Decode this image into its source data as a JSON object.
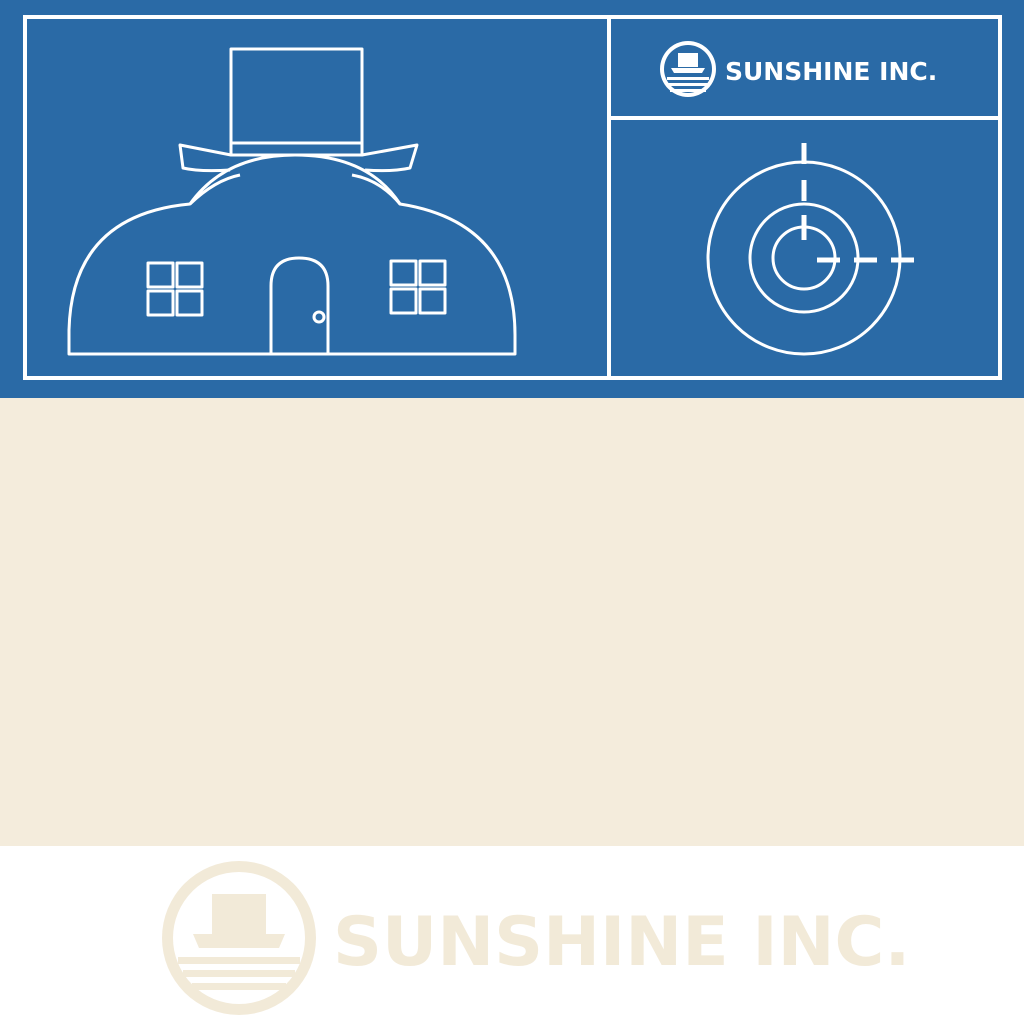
{
  "brand": {
    "name": "SUNSHINE INC."
  },
  "icons": {
    "house": "top-hat-dome-house-icon",
    "target": "radial-target-icon",
    "logo": "top-hat-sunrise-logo-icon"
  },
  "colors": {
    "primary_blue": "#2a6aa6",
    "line_white": "#ffffff",
    "cream": "#f4ecdc",
    "footer_logo": "#f2ead8",
    "footer_bg": "#ffffff"
  }
}
